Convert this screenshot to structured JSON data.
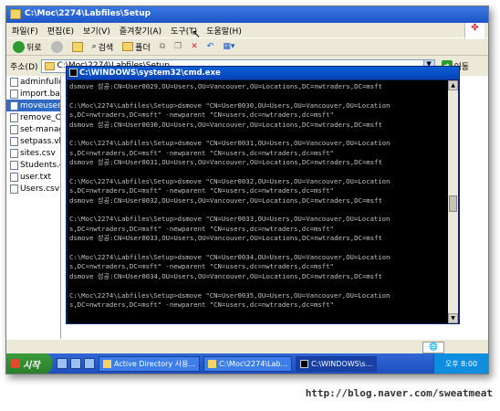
{
  "explorer": {
    "title": "C:\\Moc\\2274\\Labfiles\\Setup",
    "menu": [
      "파일(F)",
      "편집(E)",
      "보기(V)",
      "즐겨찾기(A)",
      "도구(T)",
      "도움말(H)"
    ],
    "toolbar": {
      "back": "뒤로",
      "search": "검색",
      "folders": "폴더"
    },
    "address_label": "주소(D)",
    "address_value": "C:\\Moc\\2274\\Labfiles\\Setup",
    "go_label": "이동",
    "files": [
      {
        "name": "adminfullco",
        "selected": false
      },
      {
        "name": "import.bat",
        "selected": false
      },
      {
        "name": "moveusers",
        "selected": true
      },
      {
        "name": "remove_OC",
        "selected": false
      },
      {
        "name": "set-manage",
        "selected": false
      },
      {
        "name": "setpass.vbs",
        "selected": false
      },
      {
        "name": "sites.csv",
        "selected": false
      },
      {
        "name": "Students.cs",
        "selected": false
      },
      {
        "name": "user.txt",
        "selected": false
      },
      {
        "name": "Users.csv",
        "selected": false
      }
    ]
  },
  "cmd": {
    "title": "C:\\WINDOWS\\system32\\cmd.exe",
    "lines": [
      "dsmove 성공:CN=User0029,OU=Users,OU=Vancouver,OU=Locations,DC=nwtraders,DC=msft",
      "",
      "C:\\Moc\\2274\\Labfiles\\Setup>dsmove \"CN=User0030,OU=Users,OU=Vancouver,OU=Location",
      "s,DC=nwtraders,DC=msft\" -newparent \"CN=users,dc=nwtraders,dc=msft\"",
      "dsmove 성공:CN=User0030,OU=Users,OU=Vancouver,OU=Locations,DC=nwtraders,DC=msft",
      "",
      "C:\\Moc\\2274\\Labfiles\\Setup>dsmove \"CN=User0031,OU=Users,OU=Vancouver,OU=Location",
      "s,DC=nwtraders,DC=msft\" -newparent \"CN=users,dc=nwtraders,dc=msft\"",
      "dsmove 성공:CN=User0031,OU=Users,OU=Vancouver,OU=Locations,DC=nwtraders,DC=msft",
      "",
      "C:\\Moc\\2274\\Labfiles\\Setup>dsmove \"CN=User0032,OU=Users,OU=Vancouver,OU=Location",
      "s,DC=nwtraders,DC=msft\" -newparent \"CN=users,dc=nwtraders,dc=msft\"",
      "dsmove 성공:CN=User0032,OU=Users,OU=Vancouver,OU=Locations,DC=nwtraders,DC=msft",
      "",
      "C:\\Moc\\2274\\Labfiles\\Setup>dsmove \"CN=User0033,OU=Users,OU=Vancouver,OU=Location",
      "s,DC=nwtraders,DC=msft\" -newparent \"CN=users,dc=nwtraders,dc=msft\"",
      "dsmove 성공:CN=User0033,OU=Users,OU=Vancouver,OU=Locations,DC=nwtraders,DC=msft",
      "",
      "C:\\Moc\\2274\\Labfiles\\Setup>dsmove \"CN=User0034,OU=Users,OU=Vancouver,OU=Location",
      "s,DC=nwtraders,DC=msft\" -newparent \"CN=users,dc=nwtraders,dc=msft\"",
      "dsmove 성공:CN=User0034,OU=Users,OU=Vancouver,OU=Locations,DC=nwtraders,DC=msft",
      "",
      "C:\\Moc\\2274\\Labfiles\\Setup>dsmove \"CN=User0035,OU=Users,OU=Vancouver,OU=Location",
      "s,DC=nwtraders,DC=msft\" -newparent \"CN=users,dc=nwtraders,dc=msft\""
    ]
  },
  "taskbar": {
    "start": "시작",
    "tasks": [
      {
        "label": "Active Directory 사용...",
        "active": false
      },
      {
        "label": "C:\\Moc\\2274\\Lab...",
        "active": false
      },
      {
        "label": "C:\\WINDOWS\\s...",
        "active": true
      }
    ],
    "clock": "오후 8:00"
  },
  "watermark": "http://blog.naver.com/sweatmeat"
}
